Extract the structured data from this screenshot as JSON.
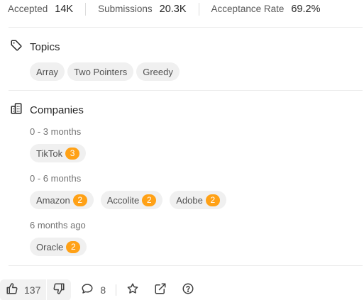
{
  "stats": {
    "accepted_label": "Accepted",
    "accepted_value": "14K",
    "submissions_label": "Submissions",
    "submissions_value": "20.3K",
    "acceptance_label": "Acceptance Rate",
    "acceptance_value": "69.2%"
  },
  "topics": {
    "title": "Topics",
    "icon": "tag-icon",
    "tags": [
      "Array",
      "Two Pointers",
      "Greedy"
    ]
  },
  "companies": {
    "title": "Companies",
    "icon": "building-icon",
    "groups": [
      {
        "period": "0 - 3 months",
        "items": [
          {
            "name": "TikTok",
            "count": "3"
          }
        ]
      },
      {
        "period": "0 - 6 months",
        "items": [
          {
            "name": "Amazon",
            "count": "2"
          },
          {
            "name": "Accolite",
            "count": "2"
          },
          {
            "name": "Adobe",
            "count": "2"
          }
        ]
      },
      {
        "period": "6 months ago",
        "items": [
          {
            "name": "Oracle",
            "count": "2"
          }
        ]
      }
    ],
    "badge_color": "#ffa116"
  },
  "actions": {
    "upvote_count": "137",
    "comment_count": "8",
    "icons": [
      "thumbs-up-icon",
      "thumbs-down-icon",
      "comment-icon",
      "star-icon",
      "share-icon",
      "help-icon"
    ]
  }
}
